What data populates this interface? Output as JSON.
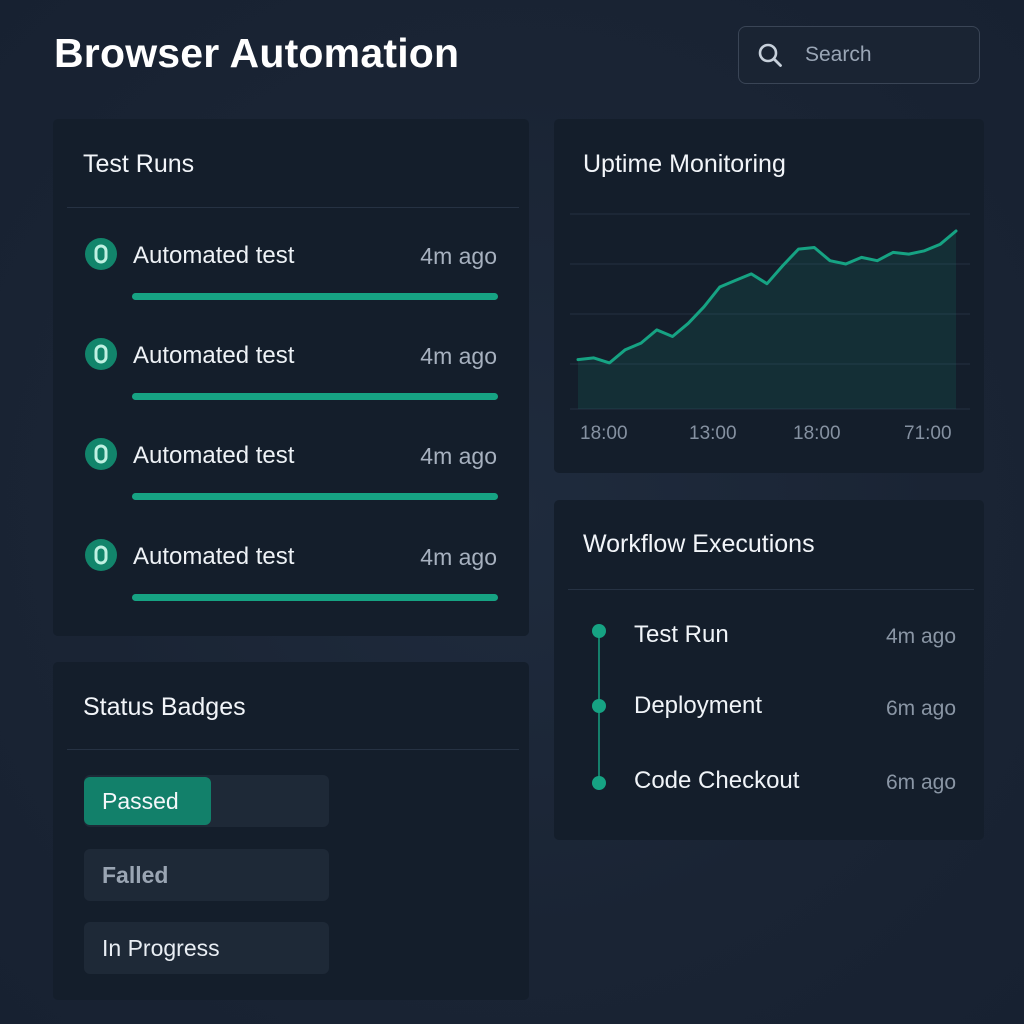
{
  "header": {
    "title": "Browser Automation",
    "search_placeholder": "Search"
  },
  "test_runs": {
    "title": "Test Runs",
    "items": [
      {
        "label": "Automated test",
        "time": "4m ago",
        "progress": 1.0
      },
      {
        "label": "Automated test",
        "time": "4m ago",
        "progress": 1.0
      },
      {
        "label": "Automated test",
        "time": "4m ago",
        "progress": 1.0
      },
      {
        "label": "Automated test",
        "time": "4m ago",
        "progress": 1.0
      }
    ]
  },
  "status_badges": {
    "title": "Status Badges",
    "items": [
      {
        "label": "Passed",
        "state": "active"
      },
      {
        "label": "Falled",
        "state": "muted"
      },
      {
        "label": "In Progress",
        "state": "plain"
      }
    ]
  },
  "uptime": {
    "title": "Uptime Monitoring",
    "chart_data": {
      "type": "area",
      "title": "Uptime Monitoring",
      "x_tick_labels": [
        "18:00",
        "13:00",
        "18:00",
        "71:00"
      ],
      "ylim": [
        0,
        100
      ],
      "grid": true,
      "values": [
        30,
        31,
        28,
        36,
        40,
        48,
        44,
        52,
        62,
        74,
        78,
        82,
        76,
        87,
        97,
        98,
        90,
        88,
        92,
        90,
        95,
        94,
        96,
        100,
        108
      ]
    }
  },
  "workflow": {
    "title": "Workflow Executions",
    "items": [
      {
        "label": "Test Run",
        "time": "4m ago"
      },
      {
        "label": "Deployment",
        "time": "6m ago"
      },
      {
        "label": "Code Checkout",
        "time": "6m ago"
      }
    ]
  },
  "colors": {
    "accent": "#16a383",
    "accent_dark": "#12806a",
    "panel": "#141e2b",
    "background": "#1a2434"
  }
}
